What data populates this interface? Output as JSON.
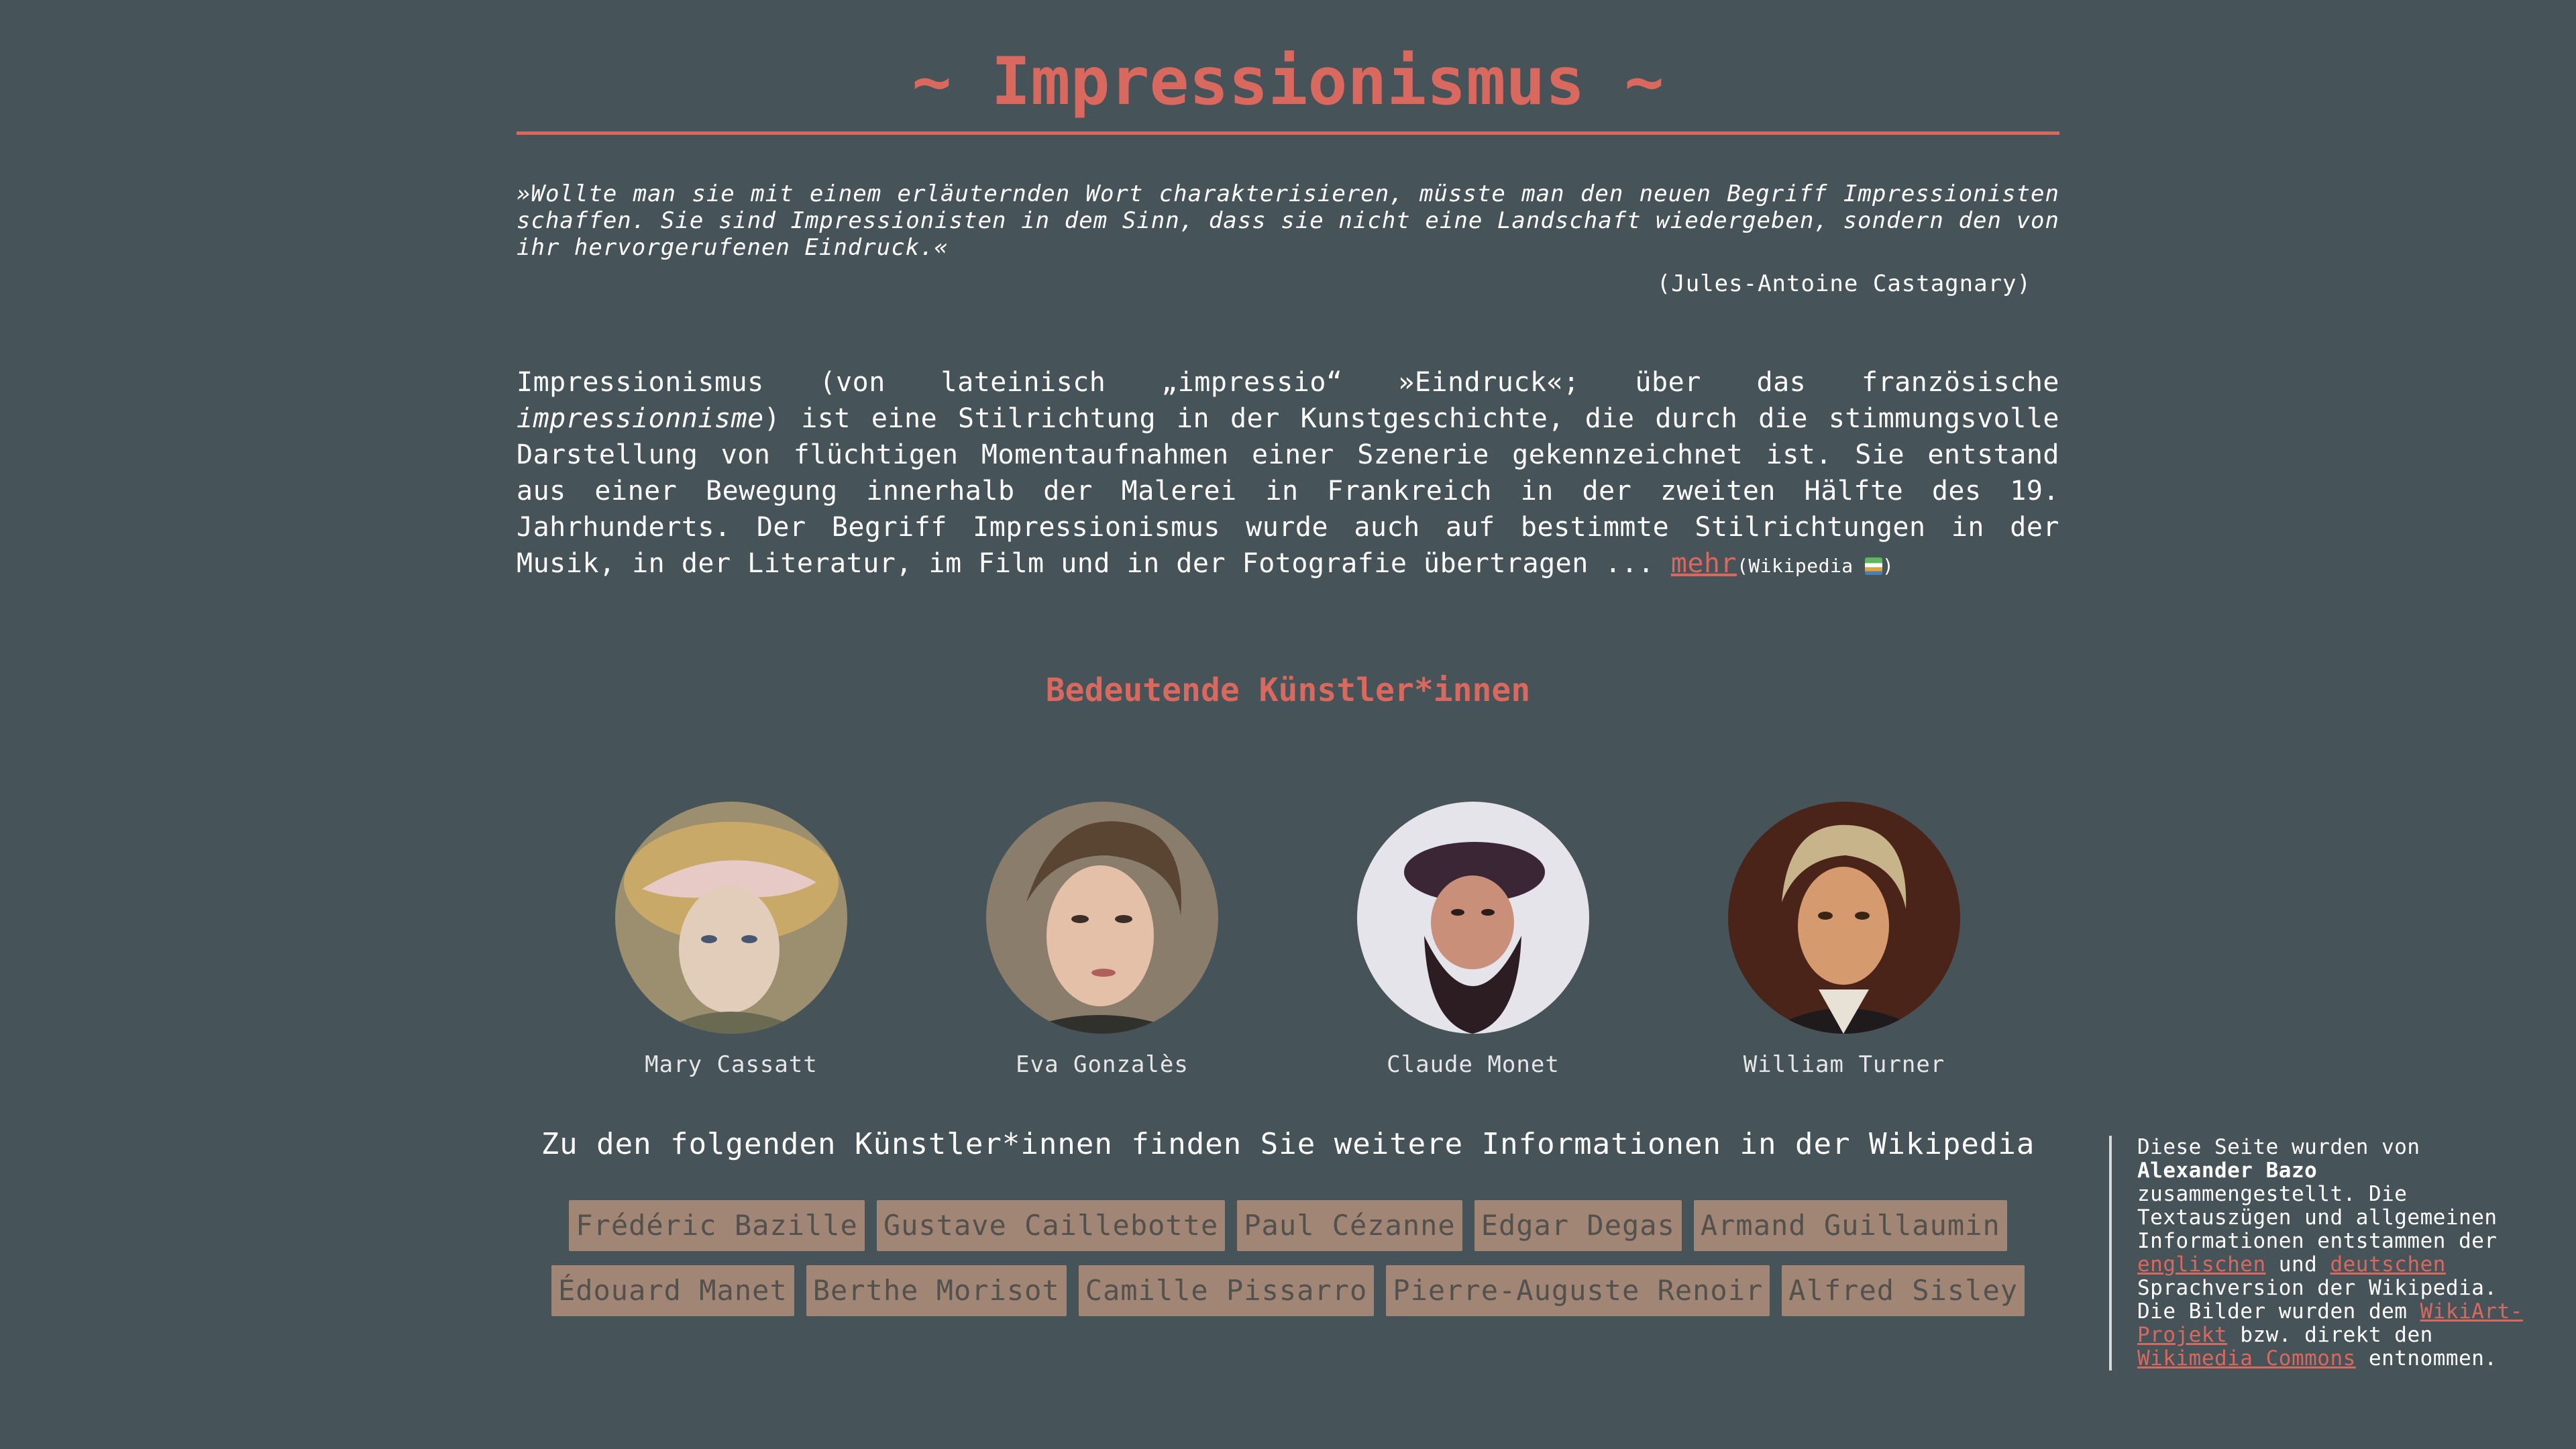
{
  "page": {
    "title": "~ Impressionismus ~",
    "accent_color": "#d9685e",
    "background_color": "#465359"
  },
  "quote": {
    "text": "»Wollte man sie mit einem erläuternden Wort charakterisieren, müsste man den neuen Begriff Impressionisten schaffen. Sie sind Impressionisten in dem Sinn, dass sie nicht eine Landschaft wiedergeben, sondern den von ihr hervorgerufenen Eindruck.«",
    "author": "(Jules-Antoine Castagnary)"
  },
  "intro": {
    "text_before": "Impressionismus (von lateinisch „impressio“ »Eindruck«; über das französische ",
    "emphasis": "impressionnisme",
    "text_after": ") ist eine Stilrichtung in der Kunstgeschichte, die durch die stimmungsvolle Darstellung von flüchtigen Momentaufnahmen einer Szenerie gekennzeichnet ist. Sie entstand aus einer Bewegung innerhalb der Malerei in Frankreich in der zweiten Hälfte des 19. Jahrhunderts. Der Begriff Impressionismus wurde auch auf bestimmte Stilrichtungen in der Musik, in der Literatur, im Film und in der Fotografie übertragen ... ",
    "more_link": "mehr",
    "source_prefix": "(Wikipedia ",
    "source_suffix": ")",
    "source_icon": "wikipedia-book-icon"
  },
  "artists_section": {
    "title": "Bedeutende Künstler*innen",
    "artists": [
      {
        "name": "Mary Cassatt"
      },
      {
        "name": "Eva Gonzalès"
      },
      {
        "name": "Claude Monet"
      },
      {
        "name": "William Turner"
      }
    ]
  },
  "more_artists": {
    "title": "Zu den folgenden Künstler*innen finden Sie weitere Informationen in der Wikipedia",
    "row1": [
      "Frédéric Bazille",
      "Gustave Caillebotte",
      "Paul Cézanne",
      "Edgar Degas",
      "Armand Guillaumin"
    ],
    "row2": [
      "Édouard Manet",
      "Berthe Morisot",
      "Camille Pissarro",
      "Pierre-Auguste Renoir",
      "Alfred Sisley"
    ]
  },
  "footer": {
    "line1": "Diese Seite wurden von",
    "author": "Alexander Bazo",
    "line2": "zusammengestellt. Die Textauszügen und allgemeinen Informationen entstammen der ",
    "link_en": "englischen",
    "and": " und ",
    "link_de": "deutschen",
    "line3": " Sprachversion der Wikipedia. Die Bilder wurden dem ",
    "link_wikiart": "WikiArt-Projekt",
    "line4": " bzw. direkt den ",
    "link_commons": "Wikimedia Commons",
    "line5": " entnommen."
  }
}
